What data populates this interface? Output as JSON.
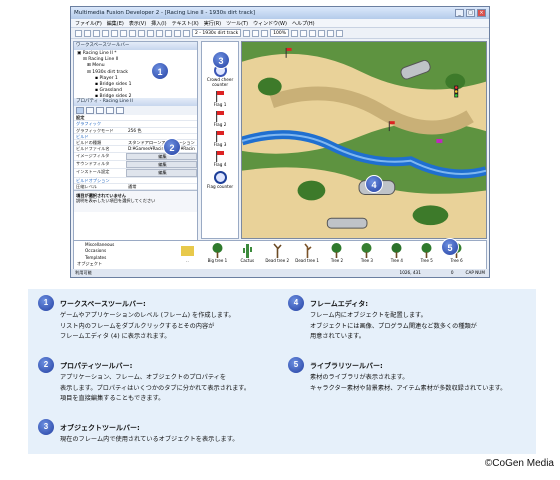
{
  "window": {
    "title": "Multimedia Fusion Developer 2 - [Racing Line II - 1930s dirt track]"
  },
  "menu": [
    "ファイル(F)",
    "編集(E)",
    "表示(V)",
    "挿入(I)",
    "テキスト(X)",
    "実行(R)",
    "ツール(T)",
    "ウィンドウ(W)",
    "ヘルプ(H)"
  ],
  "toolbar": {
    "frame_select": "2 - 1930s dirt track",
    "zoom": "100%"
  },
  "workspace": {
    "header": "ワークスペースツールバー",
    "items": [
      "Racing Line II *",
      "Racing Line II",
      "Menu",
      "1930s dirt track",
      "Player 1",
      "Bridge sides 1",
      "Grassland",
      "Bridge sides 2"
    ]
  },
  "properties": {
    "header": "プロパティ - Racing Line II",
    "rows": [
      {
        "k": "設定",
        "v": ""
      },
      {
        "k": "グラフィック",
        "v": ""
      },
      {
        "k": "グラフィックモード",
        "v": "256 色"
      },
      {
        "k": "ビルド",
        "v": ""
      },
      {
        "k": "ビルドの種類",
        "v": "スタンドアローンアプリケーション"
      },
      {
        "k": "ビルドファイル名",
        "v": "D:¥Games¥Racing Line II¥Racin"
      },
      {
        "k": "イメージフィルタ",
        "v": "編集"
      },
      {
        "k": "サウンドフィルタ",
        "v": "編集"
      },
      {
        "k": "インストール設定",
        "v": "編集"
      },
      {
        "k": "ビルドオプション",
        "v": ""
      },
      {
        "k": "圧縮レベル",
        "v": "通常"
      }
    ],
    "desc_title": "項目が選択されていません",
    "desc_body": "説明を表示したい項目を選択してください"
  },
  "objects": [
    {
      "label": "Crowd cheer counter",
      "icon": "crowd-icon"
    },
    {
      "label": "Flag 1",
      "icon": "flag-icon"
    },
    {
      "label": "Flag 2",
      "icon": "flag-icon"
    },
    {
      "label": "Flag 3",
      "icon": "flag-icon"
    },
    {
      "label": "Flag 4",
      "icon": "flag-icon"
    },
    {
      "label": "Flag counter",
      "icon": "counter-icon"
    }
  ],
  "library": {
    "tree": [
      "Miscellaneous",
      "Occasions",
      "Templates",
      "オブジェクト"
    ],
    "items": [
      "..",
      "Big tree 1",
      "Cactus",
      "Dead tree 2",
      "Dead tree 1",
      "Tree 2",
      "Tree 3",
      "Tree 4",
      "Tree 5",
      "Tree 6"
    ]
  },
  "status": {
    "left": "利用可能",
    "coords": "1026, 431",
    "zero": "0",
    "mode": "CAP NUM"
  },
  "callouts": [
    "1",
    "2",
    "3",
    "4",
    "5"
  ],
  "legend": [
    {
      "num": "1",
      "title": "ワークスペースツールバー:",
      "lines": [
        "ゲームやアプリケーションのレベル (フレーム) を作成します。",
        "リスト内のフレームをダブルクリックするとその内容が",
        "フレームエディタ (4) に表示されます。"
      ]
    },
    {
      "num": "2",
      "title": "プロパティツールバー:",
      "lines": [
        "アプリケーション、フレーム、オブジェクトのプロパティを",
        "表示します。プロパティはいくつかのタブに分かれて表示されます。",
        "項目を直接編集することもできます。"
      ]
    },
    {
      "num": "3",
      "title": "オブジェクトツールバー:",
      "lines": [
        "現在のフレーム内で使用されているオブジェクトを表示します。"
      ]
    },
    {
      "num": "4",
      "title": "フレームエディタ:",
      "lines": [
        "フレーム内にオブジェクトを配置します。",
        "オブジェクトには画像、プログラム関連など数多くの種類が",
        "用意されています。"
      ]
    },
    {
      "num": "5",
      "title": "ライブラリツールバー:",
      "lines": [
        "素材のライブラリが表示されます。",
        "キャラクター素材や背景素材、アイテム素材が多数収録されています。"
      ]
    }
  ],
  "credit": "©CoGen Media",
  "colors": {
    "callout": "#2440a2",
    "legend_bg": "#e6f0fa",
    "grass": "#5b8f3a",
    "road": "#e8cf95",
    "river": "#1f6fd0"
  }
}
